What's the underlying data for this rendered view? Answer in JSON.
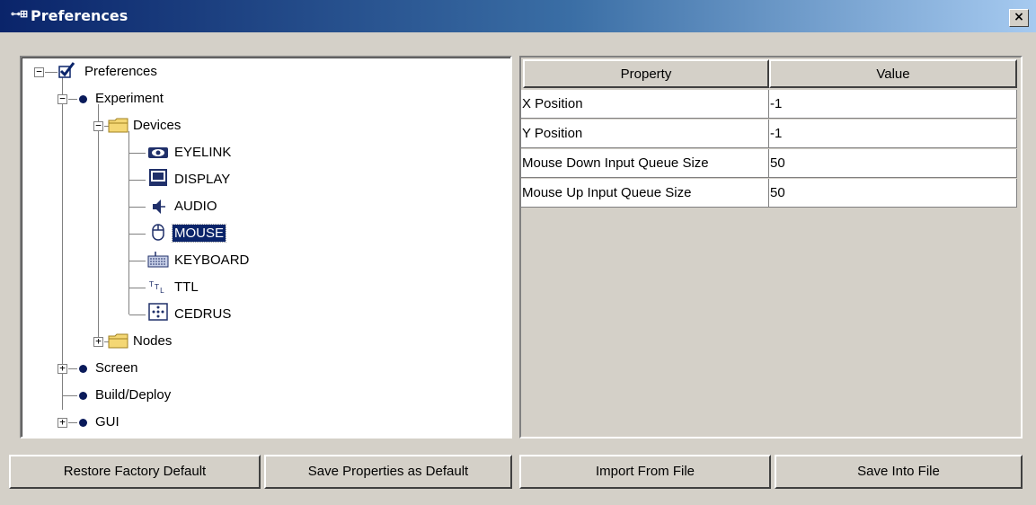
{
  "window": {
    "title": "Preferences",
    "close_label": "×"
  },
  "tree": {
    "root": "Preferences",
    "experiment": "Experiment",
    "devices": "Devices",
    "devices_children": [
      "EYELINK",
      "DISPLAY",
      "AUDIO",
      "MOUSE",
      "KEYBOARD",
      "TTL",
      "CEDRUS"
    ],
    "nodes": "Nodes",
    "screen": "Screen",
    "build_deploy": "Build/Deploy",
    "gui": "GUI",
    "selected": "MOUSE"
  },
  "properties": {
    "headers": [
      "Property",
      "Value"
    ],
    "rows": [
      {
        "property": "X Position",
        "value": "-1"
      },
      {
        "property": "Y Position",
        "value": "-1"
      },
      {
        "property": "Mouse Down Input Queue Size",
        "value": "50"
      },
      {
        "property": "Mouse Up Input Queue Size",
        "value": "50"
      }
    ]
  },
  "buttons": {
    "restore": "Restore Factory Default",
    "save_default": "Save Properties as Default",
    "import": "Import From File",
    "save_file": "Save Into File"
  },
  "colors": {
    "titlebar_start": "#0a246a",
    "titlebar_end": "#a6caf0",
    "selection": "#0a246a",
    "face": "#d4d0c8"
  },
  "icons": [
    "preferences-check-icon",
    "experiment-dot-icon",
    "folder-icon",
    "eyelink-icon",
    "display-icon",
    "audio-icon",
    "mouse-icon",
    "keyboard-icon",
    "ttl-icon",
    "cedrus-icon"
  ]
}
